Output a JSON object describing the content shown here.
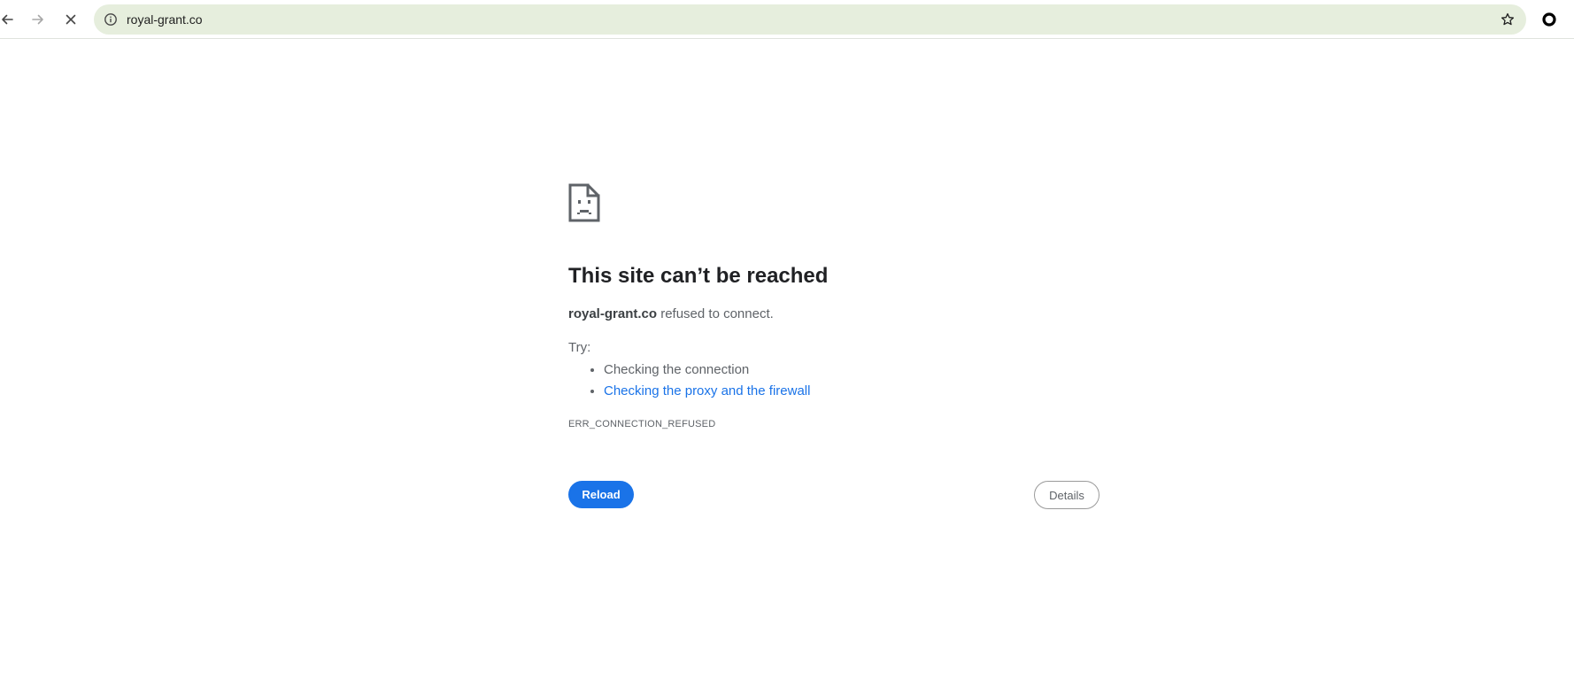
{
  "browser": {
    "url": "royal-grant.co",
    "icons": {
      "back": "back-arrow-icon",
      "forward": "forward-arrow-icon",
      "stop": "close-icon",
      "site_info": "info-icon",
      "bookmark": "star-icon",
      "extension": "circle-icon"
    }
  },
  "error_page": {
    "icon": "sad-page-icon",
    "headline": "This site can’t be reached",
    "host": "royal-grant.co",
    "summary_suffix": " refused to connect.",
    "try_label": "Try:",
    "suggestions": [
      "Checking the connection",
      "Checking the proxy and the firewall"
    ],
    "error_code": "ERR_CONNECTION_REFUSED",
    "reload_label": "Reload",
    "details_label": "Details"
  },
  "colors": {
    "omnibox_bg": "#e6eedd",
    "link": "#1a73e8",
    "primary_button": "#1a73e8",
    "headline": "#202124",
    "body_text": "#5f6368"
  }
}
